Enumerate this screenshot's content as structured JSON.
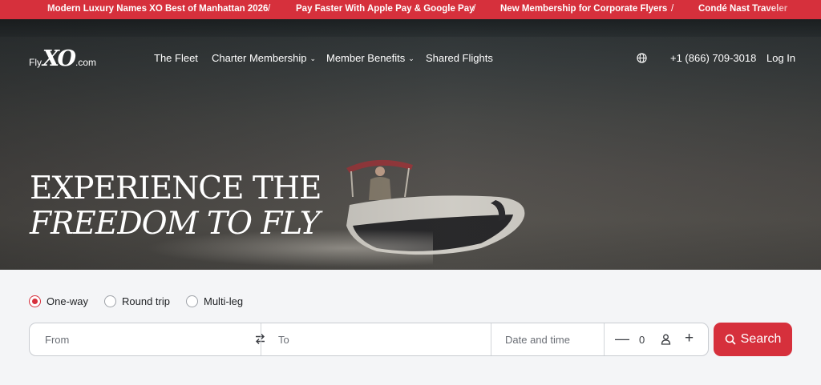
{
  "ticker": {
    "items": [
      "Modern Luxury Names XO Best of Manhattan 2026",
      "Pay Faster With Apple Pay & Google Pay",
      "New Membership for Corporate Flyers",
      "Condé Nast Traveler"
    ],
    "separator": "/"
  },
  "brand": {
    "fly": "Fly",
    "xo": "XO",
    "com": ".com"
  },
  "nav": {
    "items": [
      {
        "label": "The Fleet",
        "has_dropdown": false
      },
      {
        "label": "Charter Membership",
        "has_dropdown": true
      },
      {
        "label": "Member Benefits",
        "has_dropdown": true
      },
      {
        "label": "Shared Flights",
        "has_dropdown": false
      }
    ],
    "language_icon": "globe-icon",
    "phone": "+1 (866) 709-3018",
    "login": "Log In"
  },
  "hero": {
    "line1": "EXPERIENCE THE",
    "line2": "FREEDOM TO FLY"
  },
  "booking": {
    "trip_types": [
      {
        "label": "One-way",
        "selected": true
      },
      {
        "label": "Round trip",
        "selected": false
      },
      {
        "label": "Multi-leg",
        "selected": false
      }
    ],
    "from_placeholder": "From",
    "to_placeholder": "To",
    "date_placeholder": "Date and time",
    "passengers": "0",
    "search_label": "Search"
  },
  "colors": {
    "accent": "#d6303c",
    "panel_bg": "#f4f5f7",
    "text_dark": "#1f2124"
  }
}
